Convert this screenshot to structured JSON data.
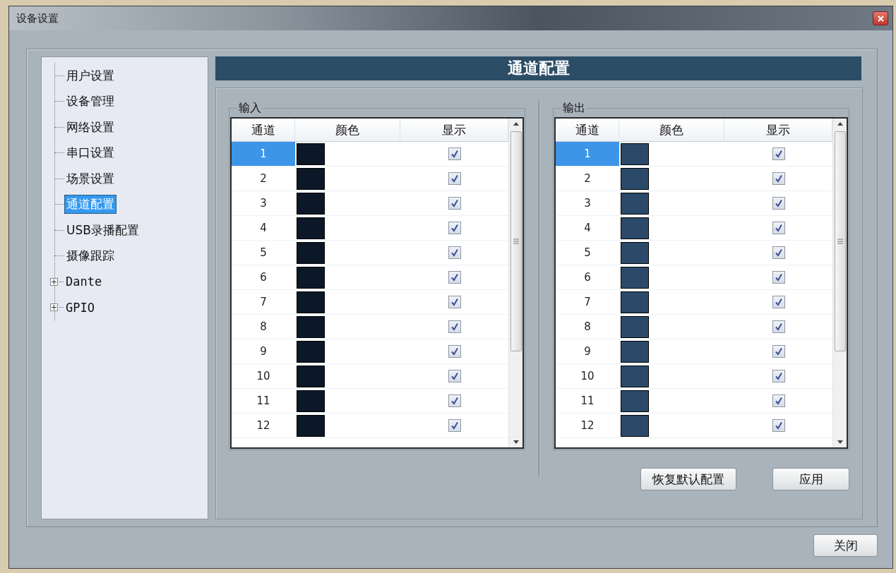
{
  "window": {
    "title": "设备设置"
  },
  "tree": [
    {
      "label": "用户设置",
      "kind": "leaf",
      "selected": false
    },
    {
      "label": "设备管理",
      "kind": "leaf",
      "selected": false
    },
    {
      "label": "网络设置",
      "kind": "leaf",
      "selected": false
    },
    {
      "label": "串口设置",
      "kind": "leaf",
      "selected": false
    },
    {
      "label": "场景设置",
      "kind": "leaf",
      "selected": false
    },
    {
      "label": "通道配置",
      "kind": "leaf",
      "selected": true
    },
    {
      "label": "USB录播配置",
      "kind": "leaf",
      "selected": false
    },
    {
      "label": "摄像跟踪",
      "kind": "leaf",
      "selected": false
    },
    {
      "label": "Dante",
      "kind": "branch",
      "expanded": false,
      "selected": false
    },
    {
      "label": "GPIO",
      "kind": "branch",
      "expanded": false,
      "selected": false
    }
  ],
  "header": "通道配置",
  "groups": [
    {
      "title": "输入",
      "columns": [
        "通道",
        "颜色",
        "显示"
      ],
      "rows": [
        {
          "channel": "1",
          "color": "#0c1828",
          "checked": true,
          "selected": true
        },
        {
          "channel": "2",
          "color": "#0c1828",
          "checked": true,
          "selected": false
        },
        {
          "channel": "3",
          "color": "#0c1828",
          "checked": true,
          "selected": false
        },
        {
          "channel": "4",
          "color": "#0c1828",
          "checked": true,
          "selected": false
        },
        {
          "channel": "5",
          "color": "#0c1828",
          "checked": true,
          "selected": false
        },
        {
          "channel": "6",
          "color": "#0c1828",
          "checked": true,
          "selected": false
        },
        {
          "channel": "7",
          "color": "#0c1828",
          "checked": true,
          "selected": false
        },
        {
          "channel": "8",
          "color": "#0c1828",
          "checked": true,
          "selected": false
        },
        {
          "channel": "9",
          "color": "#0c1828",
          "checked": true,
          "selected": false
        },
        {
          "channel": "10",
          "color": "#0c1828",
          "checked": true,
          "selected": false
        },
        {
          "channel": "11",
          "color": "#0c1828",
          "checked": true,
          "selected": false
        },
        {
          "channel": "12",
          "color": "#0c1828",
          "checked": true,
          "selected": false
        }
      ]
    },
    {
      "title": "输出",
      "columns": [
        "通道",
        "颜色",
        "显示"
      ],
      "rows": [
        {
          "channel": "1",
          "color": "#2b4a6a",
          "checked": true,
          "selected": true
        },
        {
          "channel": "2",
          "color": "#2b4a6a",
          "checked": true,
          "selected": false
        },
        {
          "channel": "3",
          "color": "#2b4a6a",
          "checked": true,
          "selected": false
        },
        {
          "channel": "4",
          "color": "#2b4a6a",
          "checked": true,
          "selected": false
        },
        {
          "channel": "5",
          "color": "#2b4a6a",
          "checked": true,
          "selected": false
        },
        {
          "channel": "6",
          "color": "#2b4a6a",
          "checked": true,
          "selected": false
        },
        {
          "channel": "7",
          "color": "#2b4a6a",
          "checked": true,
          "selected": false
        },
        {
          "channel": "8",
          "color": "#2b4a6a",
          "checked": true,
          "selected": false
        },
        {
          "channel": "9",
          "color": "#2b4a6a",
          "checked": true,
          "selected": false
        },
        {
          "channel": "10",
          "color": "#2b4a6a",
          "checked": true,
          "selected": false
        },
        {
          "channel": "11",
          "color": "#2b4a6a",
          "checked": true,
          "selected": false
        },
        {
          "channel": "12",
          "color": "#2b4a6a",
          "checked": true,
          "selected": false
        }
      ]
    }
  ],
  "actions": [
    "恢复默认配置",
    "应用"
  ],
  "footer_button": "关闭"
}
